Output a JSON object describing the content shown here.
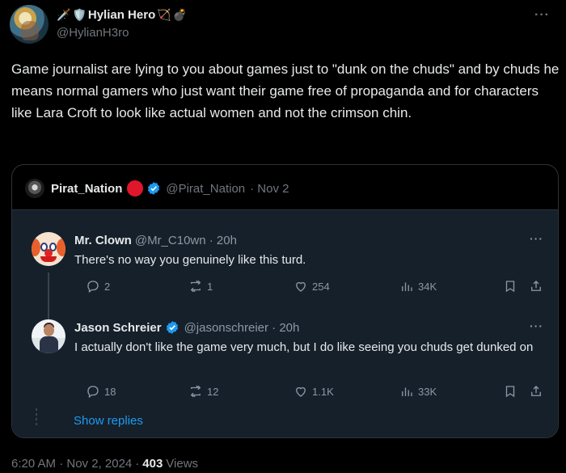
{
  "tweet": {
    "author_name": "Hylian Hero",
    "author_emojis_before": [
      "dagger",
      "shield"
    ],
    "author_emojis_after": [
      "bow-and-arrow",
      "bomb"
    ],
    "handle": "@HylianH3ro",
    "text": "Game  journalist are lying to you about games just to \"dunk on the chuds\" and by chuds he means normal gamers who just want their game free of propaganda and for characters like Lara Croft to look like actual women and not the crimson chin.",
    "timestamp": "6:20 AM · Nov 2, 2024",
    "views_count": "403",
    "views_label": "Views"
  },
  "quote": {
    "name": "Pirat_Nation",
    "handle": "@Pirat_Nation",
    "date": "· Nov 2",
    "replies": [
      {
        "name": "Mr. Clown",
        "handle": "@Mr_C10wn · 20h",
        "text": "There's no way you genuinely like this turd.",
        "replies": "2",
        "reposts": "1",
        "likes": "254",
        "views": "34K"
      },
      {
        "name": "Jason Schreier",
        "handle": "@jasonschreier · 20h",
        "text": "I actually don't like the game very much, but I do like seeing you chuds get dunked on",
        "replies": "18",
        "reposts": "12",
        "likes": "1.1K",
        "views": "33K"
      }
    ],
    "show_replies": "Show replies"
  },
  "colors": {
    "accent": "#1d9bf0",
    "dim_bg": "#15202b",
    "red_dot": "#e0162b"
  }
}
